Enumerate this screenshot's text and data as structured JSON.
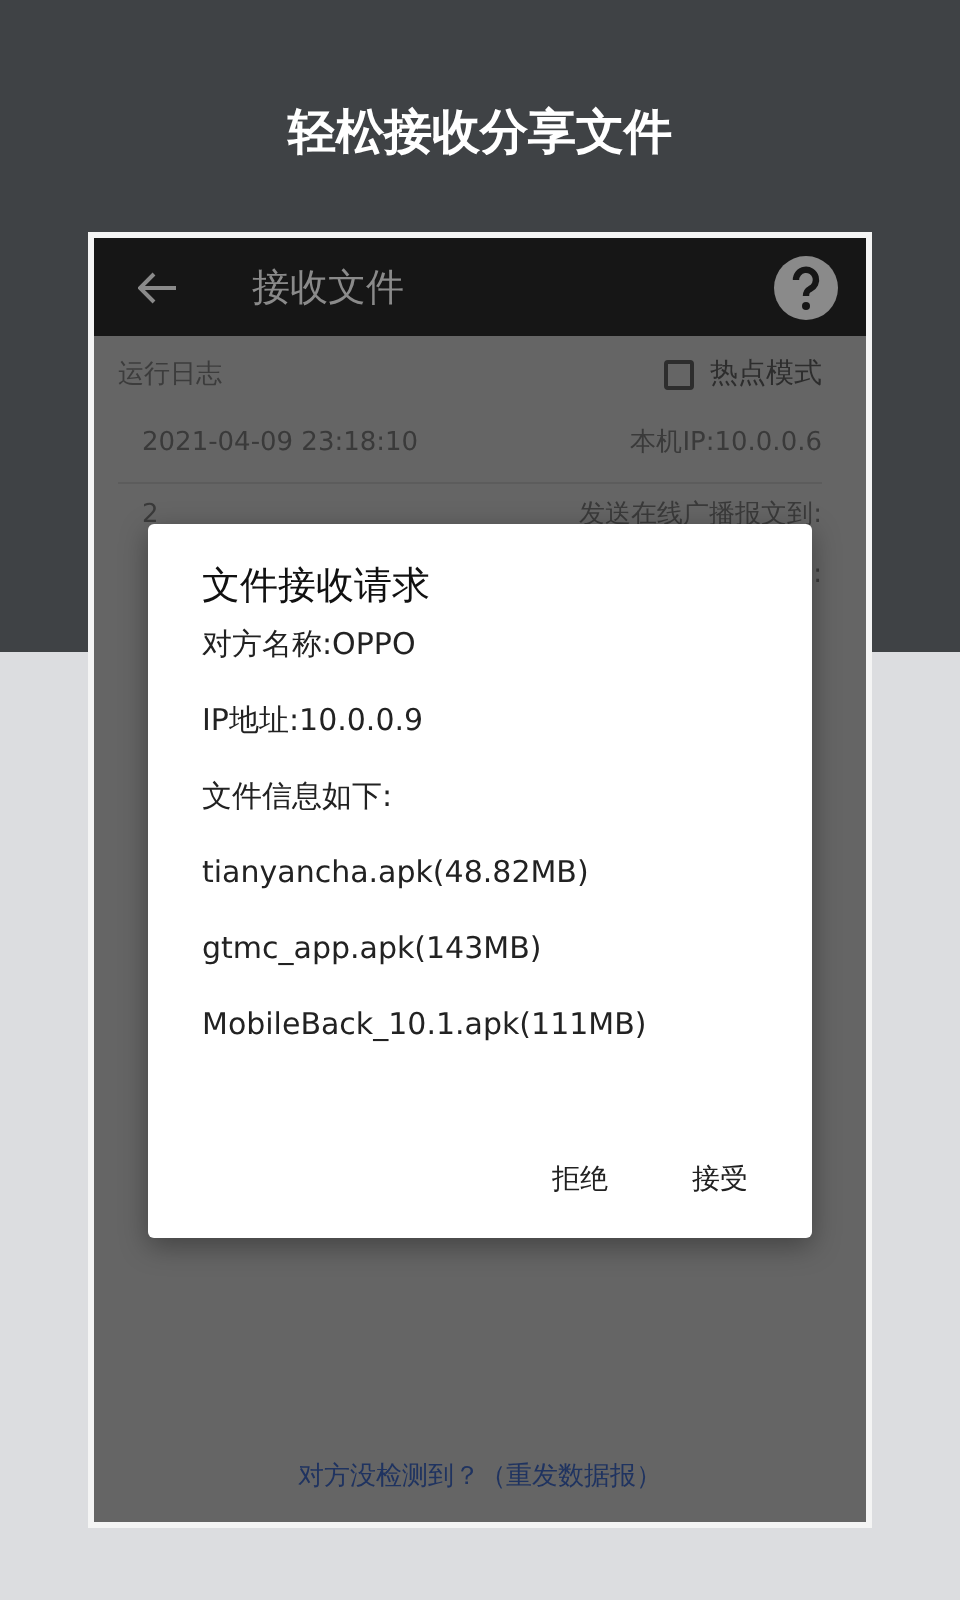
{
  "header": {
    "title": "轻松接收分享文件"
  },
  "app_bar": {
    "title": "接收文件"
  },
  "log": {
    "label": "运行日志",
    "hotspot": {
      "label": "热点模式",
      "checked": false
    },
    "entries": [
      {
        "time": "2021-04-09 23:18:10",
        "message": [
          "本机IP:10.0.0.6"
        ]
      },
      {
        "time": "2",
        "message": [
          "发送在线广播报文到:"
        ]
      },
      {
        "message": [
          ":"
        ]
      }
    ]
  },
  "dialog": {
    "title": "文件接收请求",
    "lines": [
      "对方名称:OPPO",
      "IP地址:10.0.0.9",
      "文件信息如下:",
      "tianyancha.apk(48.82MB)",
      "gtmc_app.apk(143MB)",
      "MobileBack_10.1.apk(111MB)"
    ],
    "buttons": [
      "拒绝",
      "接受"
    ]
  },
  "footer_link": "对方没检测到？（重发数据报）"
}
